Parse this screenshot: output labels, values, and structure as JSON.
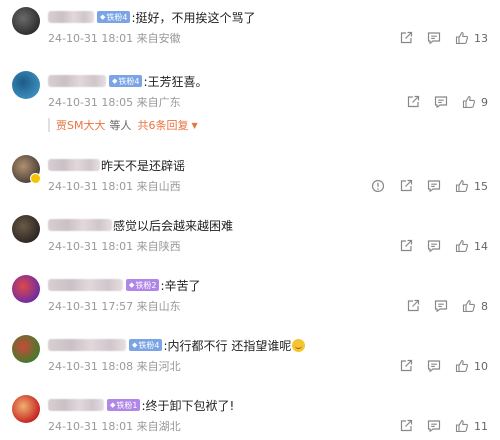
{
  "comments": [
    {
      "badge": "铁粉4",
      "badge_color": "blue",
      "text": ":挺好，不用挨这个骂了",
      "time": "24-10-31 18:01",
      "location": "来自安徽",
      "likes": "13",
      "report": false,
      "emoji": false,
      "avatar_colors": [
        "#2b2b2b",
        "#6a6a6a"
      ]
    },
    {
      "badge": "铁粉4",
      "badge_color": "blue",
      "text": ":王芳狂喜。",
      "time": "24-10-31 18:05",
      "location": "来自广东",
      "likes": "9",
      "report": false,
      "emoji": false,
      "avatar_colors": [
        "#3b8fbf",
        "#1d5b86"
      ]
    },
    {
      "badge": "",
      "badge_color": "",
      "text": "昨天不是还辟谣",
      "time": "24-10-31 18:01",
      "location": "来自山西",
      "likes": "15",
      "report": true,
      "emoji": false,
      "avatar_colors": [
        "#4a3f36",
        "#b09070"
      ]
    },
    {
      "badge": "",
      "badge_color": "",
      "text": "感觉以后会越来越困难",
      "time": "24-10-31 18:01",
      "location": "来自陕西",
      "likes": "14",
      "report": false,
      "emoji": false,
      "avatar_colors": [
        "#2a2420",
        "#6b5a48"
      ]
    },
    {
      "badge": "铁粉2",
      "badge_color": "purple",
      "text": ":辛苦了",
      "time": "24-10-31 17:57",
      "location": "来自山东",
      "likes": "8",
      "report": false,
      "emoji": false,
      "avatar_colors": [
        "#6b2aa8",
        "#e04848"
      ]
    },
    {
      "badge": "铁粉4",
      "badge_color": "blue",
      "text": ":内行都不行 还指望谁呢",
      "time": "24-10-31 18:08",
      "location": "来自河北",
      "likes": "10",
      "report": false,
      "emoji": true,
      "avatar_colors": [
        "#3f7d2a",
        "#c84a3a"
      ]
    },
    {
      "badge": "铁粉1",
      "badge_color": "purple",
      "text": ":终于卸下包袱了!",
      "time": "24-10-31 18:01",
      "location": "来自湖北",
      "likes": "11",
      "report": false,
      "emoji": false,
      "avatar_colors": [
        "#c41e1e",
        "#f0b070"
      ]
    }
  ],
  "reply_preview": {
    "name": "贾SM大大",
    "middle": "等人",
    "count_label": "共6条回复"
  },
  "icons": {
    "share": "share-icon",
    "comment": "comment-icon",
    "like": "like-icon",
    "report": "report-icon"
  }
}
